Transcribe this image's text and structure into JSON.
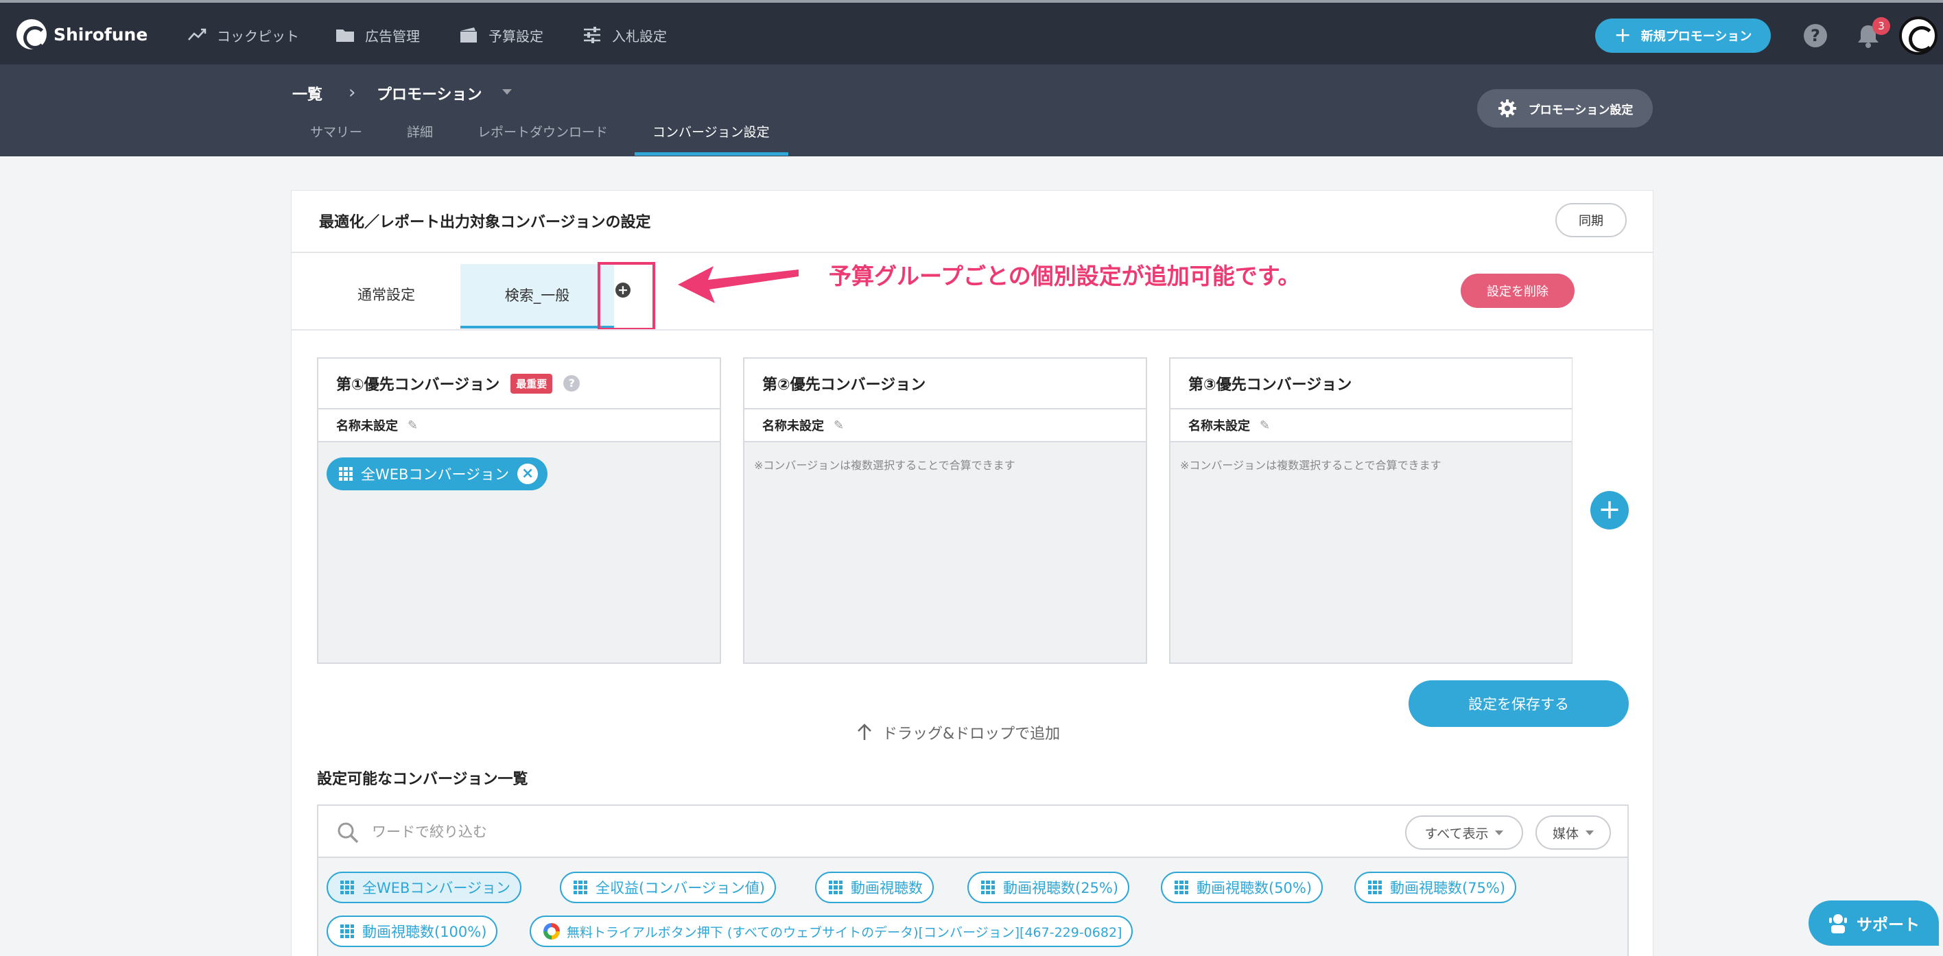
{
  "app": {
    "name": "Shirofune"
  },
  "nav": {
    "items": [
      {
        "label": "コックピット",
        "icon": "trend-icon"
      },
      {
        "label": "広告管理",
        "icon": "folder-icon"
      },
      {
        "label": "予算設定",
        "icon": "wallet-icon"
      },
      {
        "label": "入札設定",
        "icon": "sliders-icon"
      }
    ],
    "new_promotion": "新規プロモーション",
    "help": "?",
    "notification_count": "3"
  },
  "subheader": {
    "breadcrumb": [
      "一覧",
      "プロモーション"
    ],
    "tabs": [
      "サマリー",
      "詳細",
      "レポートダウンロード",
      "コンバージョン設定"
    ],
    "active_tab": "コンバージョン設定",
    "promotion_settings": "プロモーション設定"
  },
  "card": {
    "title": "最適化／レポート出力対象コンバージョンの設定",
    "sync": "同期",
    "tabs": [
      "通常設定",
      "検索_一般"
    ],
    "add_tab": "+",
    "delete": "設定を削除"
  },
  "annotation": "予算グループごとの個別設定が追加可能です。",
  "priorities": [
    {
      "title": "第①優先コンバージョン",
      "badge": "最重要",
      "name": "名称未設定",
      "chips": [
        {
          "label": "全WEBコンバージョン"
        }
      ]
    },
    {
      "title": "第②優先コンバージョン",
      "name": "名称未設定",
      "hint": "※コンバージョンは複数選択することで合算できます"
    },
    {
      "title": "第③優先コンバージョン",
      "name": "名称未設定",
      "hint": "※コンバージョンは複数選択することで合算できます"
    }
  ],
  "save": "設定を保存する",
  "drag_hint": "ドラッグ&ドロップで追加",
  "list": {
    "title": "設定可能なコンバージョン一覧",
    "search_placeholder": "ワードで絞り込む",
    "filter_all": "すべて表示",
    "filter_media": "媒体",
    "chips": [
      {
        "label": "全WEBコンバージョン",
        "selected": true
      },
      {
        "label": "全収益(コンバージョン値)"
      },
      {
        "label": "動画視聴数"
      },
      {
        "label": "動画視聴数(25%)"
      },
      {
        "label": "動画視聴数(50%)"
      },
      {
        "label": "動画視聴数(75%)"
      },
      {
        "label": "動画視聴数(100%)"
      },
      {
        "label": "無料トライアルボタン押下 (すべてのウェブサイトのデータ)[コンバージョン][467-229-0682]",
        "icon": "google-icon"
      }
    ]
  },
  "support": "サポート",
  "colors": {
    "accent": "#32a8d8",
    "danger": "#e0495c",
    "annotation": "#ee3a72",
    "nav_bg": "#2a303c"
  }
}
